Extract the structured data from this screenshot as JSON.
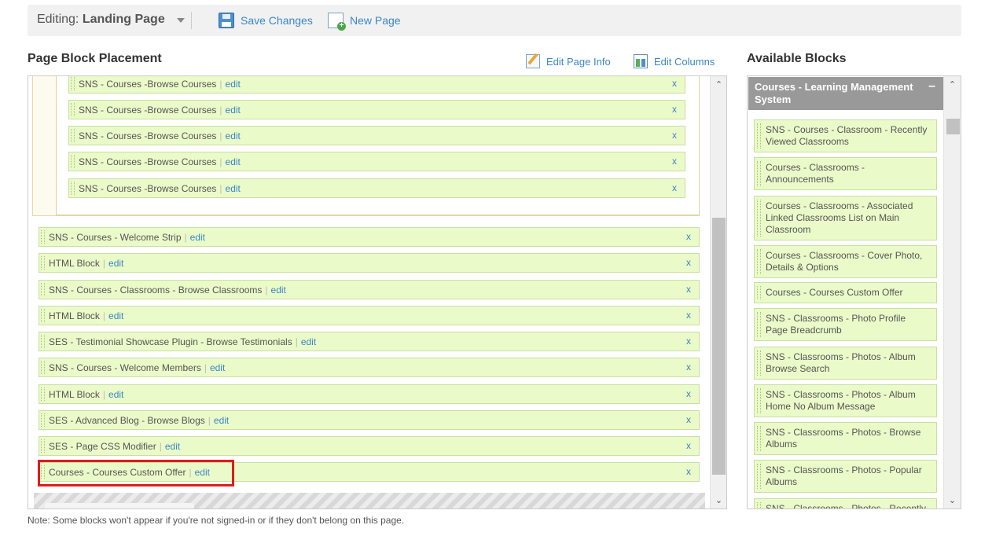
{
  "toolbar": {
    "editing_prefix": "Editing:",
    "page_name": "Landing Page",
    "save_label": "Save Changes",
    "new_page_label": "New Page"
  },
  "placement": {
    "title": "Page Block Placement",
    "edit_info_label": "Edit Page Info",
    "edit_columns_label": "Edit Columns",
    "edit_link": "edit",
    "remove_link": "x",
    "inner_blocks": [
      "SNS - Courses -Browse Courses",
      "SNS - Courses -Browse Courses",
      "SNS - Courses -Browse Courses",
      "SNS - Courses -Browse Courses",
      "SNS - Courses -Browse Courses"
    ],
    "blocks": [
      "SNS - Courses - Welcome Strip",
      "HTML Block",
      "SNS - Courses - Classrooms - Browse Classrooms",
      "HTML Block",
      "SES - Testimonial Showcase Plugin - Browse Testimonials",
      "SNS - Courses - Welcome Members",
      "HTML Block",
      "SES - Advanced Blog - Browse Blogs",
      "SES - Page CSS Modifier",
      "Courses - Courses Custom Offer"
    ]
  },
  "available": {
    "title": "Available Blocks",
    "category": "Courses - Learning Management System",
    "collapse_symbol": "–",
    "items": [
      "SNS - Courses - Classroom - Recently Viewed Classrooms",
      "Courses - Classrooms - Announcements",
      "Courses - Classrooms - Associated Linked Classrooms List on Main Classroom",
      "Courses - Classrooms - Cover Photo, Details & Options",
      "Courses - Courses Custom Offer",
      "SNS - Classrooms - Photo Profile Page Breadcrumb",
      "SNS - Classrooms - Photos - Album Browse Search",
      "SNS - Classrooms - Photos - Album Home No Album Message",
      "SNS - Classrooms - Photos - Browse Albums",
      "SNS - Classrooms - Photos - Popular Albums",
      "SNS - Classrooms - Photos - Recently"
    ]
  },
  "note": "Note: Some blocks won't appear if you're not signed-in or if they don't belong on this page.",
  "scroll": {
    "up": "⌃",
    "down": "⌄"
  }
}
